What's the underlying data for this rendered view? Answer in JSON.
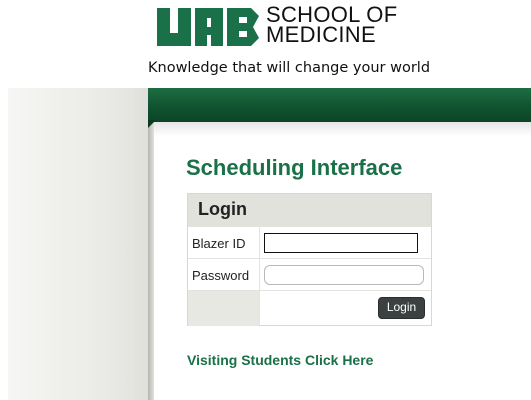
{
  "header": {
    "logo_letters": "UAB",
    "school_line1": "SCHOOL OF",
    "school_line2": "MEDICINE",
    "tagline": "Knowledge that will change your world"
  },
  "colors": {
    "brand_green": "#1a7048",
    "band_green": "#115430"
  },
  "main": {
    "title": "Scheduling Interface",
    "visiting_link": "Visiting Students Click Here"
  },
  "login": {
    "header": "Login",
    "blazer_id_label": "Blazer ID",
    "blazer_id_value": "",
    "password_label": "Password",
    "password_value": "",
    "submit_label": "Login"
  }
}
